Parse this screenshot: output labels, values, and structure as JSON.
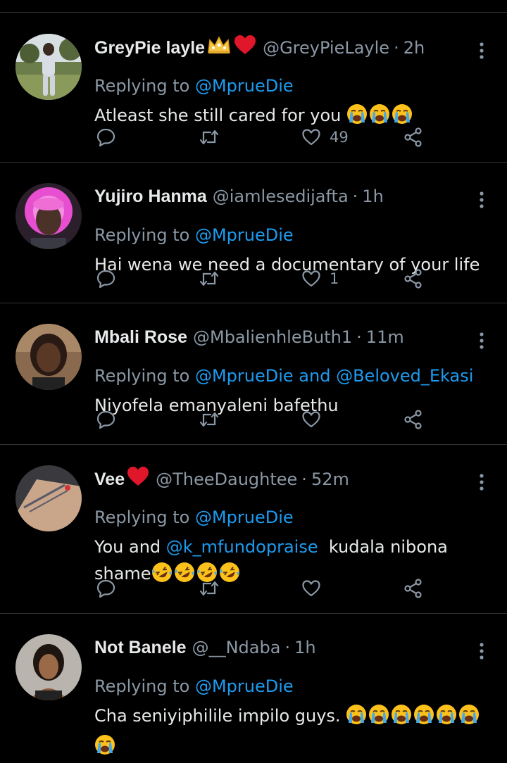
{
  "colors": {
    "background": "#000000",
    "divider": "#2f3336",
    "name": "#e7e9ea",
    "secondary": "#8b98a5",
    "link": "#1d9bf0"
  },
  "replying_prefix": "Replying to",
  "and_word": "and",
  "icons": {
    "reply": "speech-bubble-icon",
    "retweet": "retweet-arrows-icon",
    "like": "heart-icon",
    "share": "share-nodes-icon",
    "more": "vertical-dots-icon"
  },
  "replies": [
    {
      "name": "GreyPie layle",
      "name_decorations": [
        "crown-emoji",
        "red-heart-emoji"
      ],
      "handle": "@GreyPieLayle",
      "sep": "·",
      "time": "2h",
      "replying_to": [
        "@MprueDie"
      ],
      "text": "Atleast she still cared for you",
      "text_emojis": [
        "loudly-crying-face",
        "loudly-crying-face",
        "loudly-crying-face"
      ],
      "likes": "49"
    },
    {
      "name": "Yujiro Hanma",
      "name_decorations": [],
      "handle": "@iamlesedijafta",
      "sep": "·",
      "time": "1h",
      "replying_to": [
        "@MprueDie"
      ],
      "text": "Hai wena we need a documentary of your life",
      "text_emojis": [],
      "likes": "1"
    },
    {
      "name": "Mbali Rose",
      "name_decorations": [],
      "handle": "@MbalienhleButh1",
      "sep": "·",
      "time": "11m",
      "replying_to": [
        "@MprueDie",
        "@Beloved_Ekasi"
      ],
      "text": "Niyofela emanyaleni bafethu",
      "text_emojis": [],
      "likes": ""
    },
    {
      "name": "Vee",
      "name_decorations": [
        "red-heart-emoji"
      ],
      "handle": "@TheeDaughtee",
      "sep": "·",
      "time": "52m",
      "replying_to": [
        "@MprueDie"
      ],
      "text_part1": "You and ",
      "text_mention": "@k_mfundopraise",
      "text_part2": "  kudala nibona shame",
      "text_emojis": [
        "rolling-on-floor-laughing",
        "rolling-on-floor-laughing",
        "rolling-on-floor-laughing",
        "rolling-on-floor-laughing"
      ],
      "likes": ""
    },
    {
      "name": "Not Banele",
      "name_decorations": [],
      "handle": "@__Ndaba",
      "sep": "·",
      "time": "1h",
      "replying_to": [
        "@MprueDie"
      ],
      "text": "Cha seniyiphilile impilo guys. ",
      "text_emojis": [
        "loudly-crying-face",
        "loudly-crying-face",
        "loudly-crying-face",
        "loudly-crying-face",
        "loudly-crying-face",
        "loudly-crying-face",
        "loudly-crying-face"
      ],
      "likes": ""
    }
  ]
}
